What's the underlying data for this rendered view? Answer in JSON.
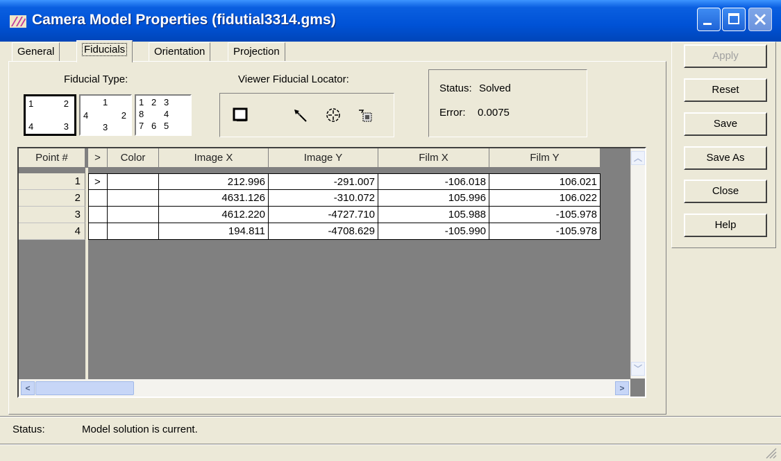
{
  "window": {
    "title": "Camera Model Properties (fidutial3314.gms)"
  },
  "tabs": [
    {
      "label": "General",
      "active": false
    },
    {
      "label": "Fiducials",
      "active": true
    },
    {
      "label": "Orientation",
      "active": false
    },
    {
      "label": "Projection",
      "active": false
    }
  ],
  "fiducial_type": {
    "label": "Fiducial Type:",
    "options": [
      {
        "name": "4-corner",
        "selected": true,
        "numbers": [
          "1",
          "2",
          "4",
          "3"
        ]
      },
      {
        "name": "4-side",
        "selected": false,
        "numbers": [
          "1",
          "4",
          "2",
          "3"
        ]
      },
      {
        "name": "8-point",
        "selected": false,
        "numbers": [
          "1",
          "2",
          "3",
          "8",
          "4",
          "7",
          "6",
          "5"
        ]
      }
    ]
  },
  "viewer_locator": {
    "label": "Viewer Fiducial Locator:",
    "icons": [
      "viewer-window-icon",
      "pointer-arrow-icon",
      "target-crosshair-icon",
      "auto-locate-icon"
    ]
  },
  "status_panel": {
    "status_label": "Status:",
    "status_value": "Solved",
    "error_label": "Error:",
    "error_value": "0.0075"
  },
  "grid": {
    "columns": [
      "Point #",
      ">",
      "Color",
      "Image X",
      "Image Y",
      "Film X",
      "Film Y"
    ],
    "rows": [
      {
        "point": "1",
        "marker": ">",
        "color": "",
        "image_x": "212.996",
        "image_y": "-291.007",
        "film_x": "-106.018",
        "film_y": "106.021"
      },
      {
        "point": "2",
        "marker": "",
        "color": "",
        "image_x": "4631.126",
        "image_y": "-310.072",
        "film_x": "105.996",
        "film_y": "106.022"
      },
      {
        "point": "3",
        "marker": "",
        "color": "",
        "image_x": "4612.220",
        "image_y": "-4727.710",
        "film_x": "105.988",
        "film_y": "-105.978"
      },
      {
        "point": "4",
        "marker": "",
        "color": "",
        "image_x": "194.811",
        "image_y": "-4708.629",
        "film_x": "-105.990",
        "film_y": "-105.978"
      }
    ]
  },
  "buttons": {
    "apply": "Apply",
    "reset": "Reset",
    "save": "Save",
    "save_as": "Save As",
    "close": "Close",
    "help": "Help"
  },
  "statusbar": {
    "label": "Status:",
    "message": "Model solution is current."
  }
}
